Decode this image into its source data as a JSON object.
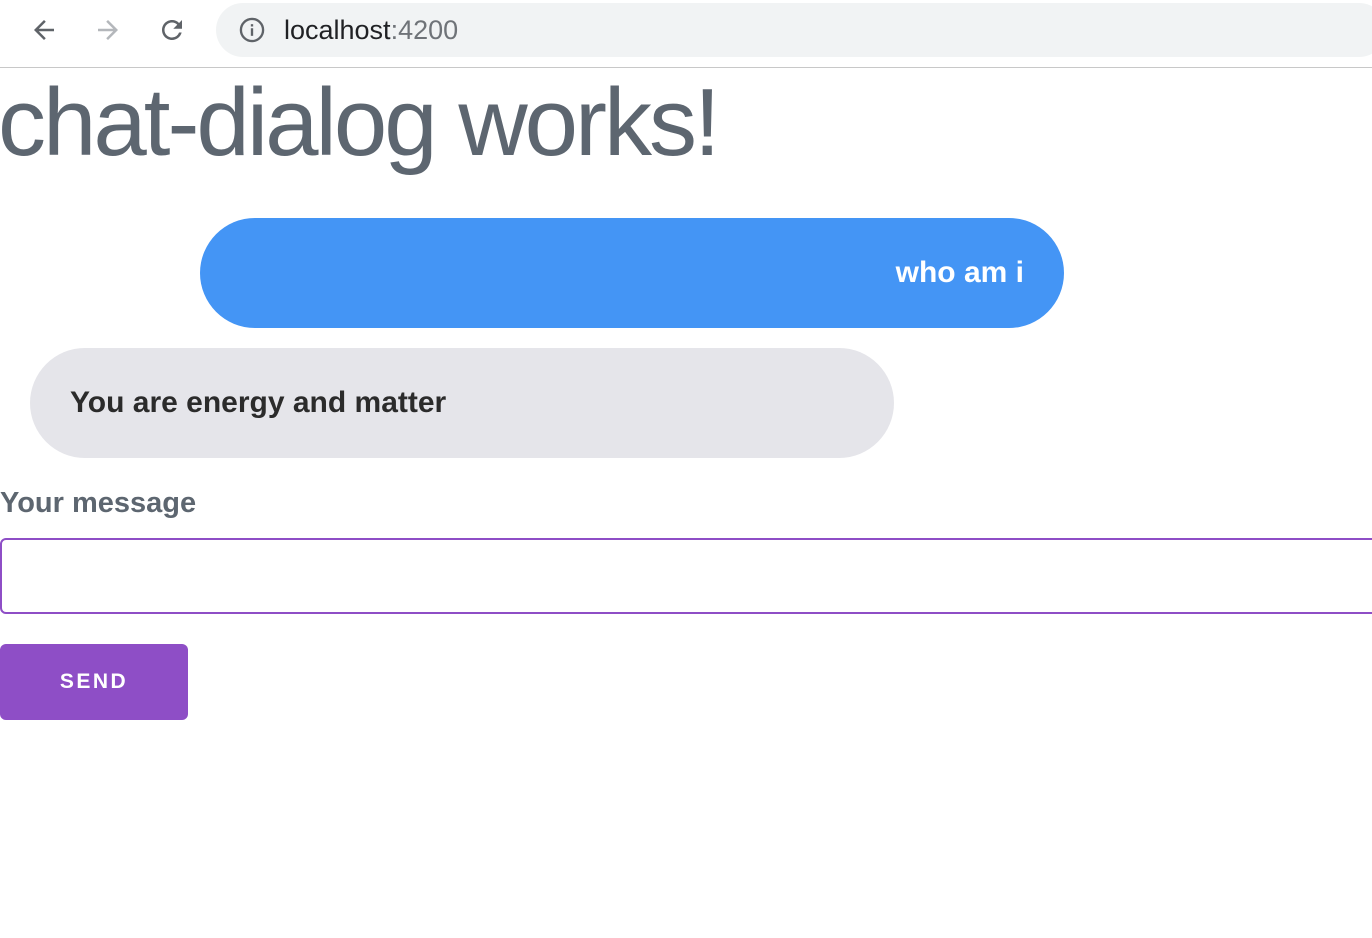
{
  "browser": {
    "url_host": "localhost",
    "url_port": ":4200",
    "icons": {
      "back": "arrow-left",
      "forward": "arrow-right",
      "reload": "reload",
      "info": "info-circle"
    }
  },
  "page": {
    "title": "chat-dialog works!"
  },
  "chat": {
    "messages": [
      {
        "sender": "user",
        "text": "who am i",
        "color": "#4495f5"
      },
      {
        "sender": "bot",
        "text": "You are energy and matter",
        "color": "#e5e5ea"
      }
    ]
  },
  "form": {
    "label": "Your message",
    "input_value": "",
    "send_label": "SEND",
    "accent_color": "#8e4ec6"
  }
}
